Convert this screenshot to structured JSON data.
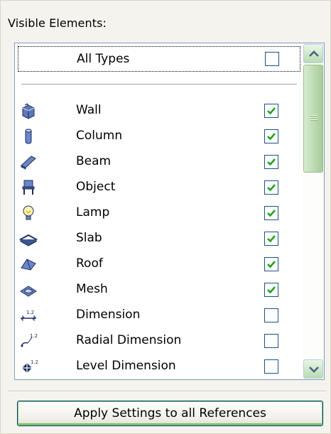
{
  "section": {
    "title": "Visible Elements:"
  },
  "all_types": {
    "label": "All Types",
    "checked": false
  },
  "element_types": [
    {
      "label": "Wall",
      "icon": "wall-icon",
      "checked": true
    },
    {
      "label": "Column",
      "icon": "column-icon",
      "checked": true
    },
    {
      "label": "Beam",
      "icon": "beam-icon",
      "checked": true
    },
    {
      "label": "Object",
      "icon": "object-icon",
      "checked": true
    },
    {
      "label": "Lamp",
      "icon": "lamp-icon",
      "checked": true
    },
    {
      "label": "Slab",
      "icon": "slab-icon",
      "checked": true
    },
    {
      "label": "Roof",
      "icon": "roof-icon",
      "checked": true
    },
    {
      "label": "Mesh",
      "icon": "mesh-icon",
      "checked": true
    },
    {
      "label": "Dimension",
      "icon": "dimension-icon",
      "checked": false
    },
    {
      "label": "Radial Dimension",
      "icon": "radial-dimension-icon",
      "checked": false
    },
    {
      "label": "Level Dimension",
      "icon": "level-dimension-icon",
      "checked": false
    }
  ],
  "apply_button": {
    "label": "Apply Settings to all References"
  },
  "colors": {
    "checkbox_border": "#1c5180",
    "list_border": "#7f9db9",
    "scrollbar_green": "#b7dbb0"
  }
}
